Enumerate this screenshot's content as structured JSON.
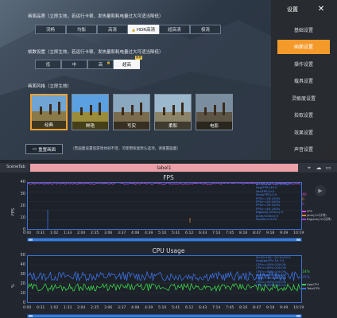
{
  "game_settings": {
    "quality": {
      "title": "画面品质（立即生效，若运行卡顿、发热量和耗电量过大可适当降低）",
      "options": [
        "流畅",
        "均衡",
        "高清",
        "HDR高清",
        "超高清",
        "极清"
      ],
      "selected": 3
    },
    "fps": {
      "title": "帧数设置（立即生效，若运行卡顿、发热量和耗电量过大可适当降低）",
      "options": [
        "低",
        "中",
        "高",
        "超高"
      ],
      "selected": 3,
      "badge": "推荐"
    },
    "style": {
      "title": "画面风格（立即生效）",
      "options": [
        "经典",
        "鲜艳",
        "写实",
        "柔和",
        "电影"
      ],
      "selected": 0
    },
    "reset_label": "重置画面",
    "reset_note": "（若画面设置后游戏体验不佳，可使用恢复默认选项，请重置画面）"
  },
  "sidebar": {
    "title": "设置",
    "items": [
      "基础设置",
      "画面设置",
      "操作设置",
      "载具设置",
      "灵敏度设置",
      "拾取设置",
      "效果设置",
      "声音设置",
      "录像设置"
    ],
    "active": 1
  },
  "perf": {
    "scene_label": "SceneTab",
    "label_bar": "label1",
    "fps_chart": {
      "title": "FPS",
      "ylabel": "FPS",
      "yticks": [
        "0",
        "10",
        "20",
        "30",
        "40"
      ],
      "legend_text": "00:00:19A~10:10:00.0\nAvg(FPS):40.0\nVar(FPS):0.0\nDrop(FPS):0.0\nFPS>=18:100%\nFPS>=25:100%\nFPS>=30:100%\nFPS>=40:100%\nBigJank(/10min):0\nJank(/10min):0\nStutter:0.24%",
      "val_fps": "40",
      "val_jank": "0",
      "val_bigjank": "0",
      "legend_items": [
        "FPS",
        "Jank(/10分钟)",
        "BigJank(/10分钟)"
      ],
      "series_colors": {
        "fps": "#e04ad8",
        "jank": "#e08830",
        "bigjank": "#a040e0"
      }
    },
    "cpu_chart": {
      "title": "CPU Usage",
      "ylabel": "%",
      "yticks": [
        "0",
        "10",
        "20",
        "30",
        "40",
        "50"
      ],
      "legend_text": "00:00:19A~10:10:00.0\nAvgAppCPU:16.1%\nCPU<=50%:100.0%\nCPU<=60%:100.0%\nCPU<=80%:100.0%\nAvgTotalCPU:28.8%\nCPU<=50%:100.0%\nCPU<=60%:100.0%\nCPU<=80%:100.0%",
      "val_app": "14%",
      "val_total": "25%",
      "legend_items": [
        "AppCPU",
        "TotalCPU"
      ],
      "series_colors": {
        "app": "#3ad14a",
        "total": "#3a6fe0"
      }
    },
    "x_ticks": [
      "0:00",
      "0:31",
      "1:02",
      "1:33",
      "2:04",
      "2:35",
      "3:06",
      "3:37",
      "4:08",
      "4:39",
      "5:10",
      "5:41",
      "6:12",
      "6:43",
      "7:14",
      "7:45",
      "8:16",
      "8:47",
      "9:18",
      "9:49",
      "10:19"
    ]
  }
}
